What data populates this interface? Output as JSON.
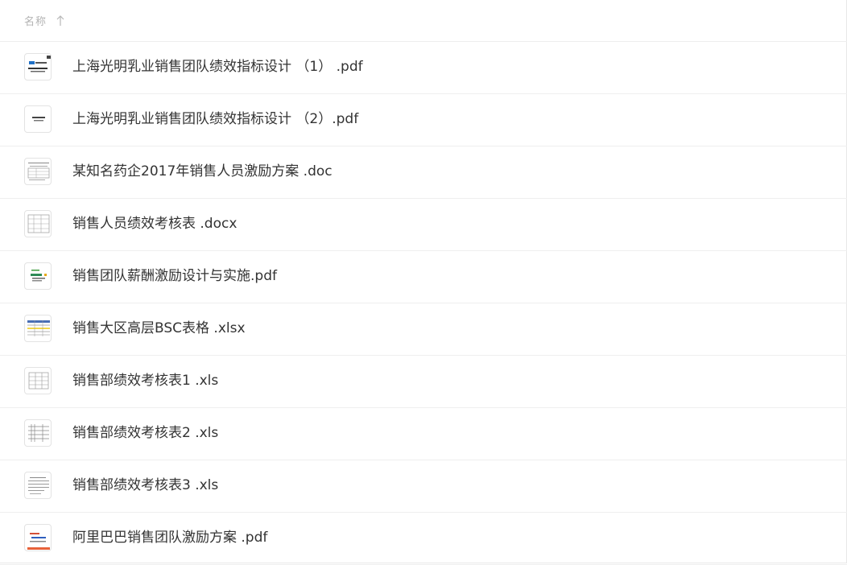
{
  "header": {
    "column_label": "名称",
    "sort_direction": "ascending"
  },
  "files": [
    {
      "name": "上海光明乳业销售团队绩效指标设计 （1） .pdf",
      "thumbnail": "pdf-cover-logo-thumbnail"
    },
    {
      "name": "上海光明乳业销售团队绩效指标设计 （2）.pdf",
      "thumbnail": "pdf-cover-text-thumbnail"
    },
    {
      "name": "某知名药企2017年销售人员激励方案 .doc",
      "thumbnail": "doc-form-thumbnail"
    },
    {
      "name": "销售人员绩效考核表 .docx",
      "thumbnail": "docx-table-thumbnail"
    },
    {
      "name": "销售团队薪酬激励设计与实施.pdf",
      "thumbnail": "pdf-slide-thumbnail"
    },
    {
      "name": "销售大区高层BSC表格 .xlsx",
      "thumbnail": "xlsx-sheet-thumbnail"
    },
    {
      "name": "销售部绩效考核表1 .xls",
      "thumbnail": "xls-sheet-thumbnail"
    },
    {
      "name": "销售部绩效考核表2 .xls",
      "thumbnail": "xls-grid-thumbnail"
    },
    {
      "name": "销售部绩效考核表3 .xls",
      "thumbnail": "xls-form-thumbnail"
    },
    {
      "name": "阿里巴巴销售团队激励方案 .pdf",
      "thumbnail": "pdf-cover-thumbnail"
    }
  ]
}
